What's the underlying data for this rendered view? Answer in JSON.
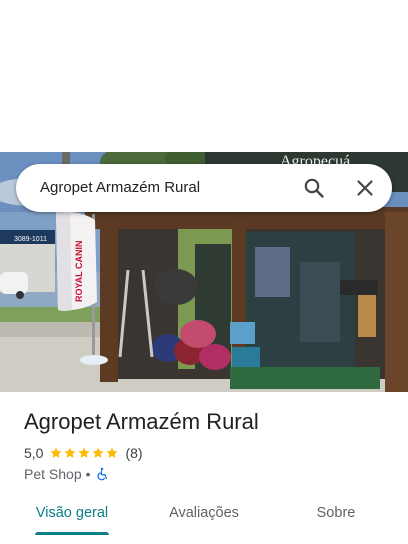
{
  "search": {
    "query": "Agropet Armazém Rural"
  },
  "place": {
    "name": "Agropet Armazém Rural",
    "rating": "5,0",
    "stars": 5,
    "review_count": "(8)",
    "category": "Pet Shop",
    "separator": "•"
  },
  "photo": {
    "storefront_sign": "Agropecuá",
    "flag_brand": "ROYAL CANIN",
    "roadside_sign": "3089-1011"
  },
  "tabs": [
    {
      "label": "Visão geral",
      "active": true
    },
    {
      "label": "Avaliações",
      "active": false
    },
    {
      "label": "Sobre",
      "active": false
    }
  ],
  "colors": {
    "accent": "#0b7f86",
    "star": "#fbbc04"
  },
  "icons": {
    "search": "search-icon",
    "close": "close-icon",
    "accessibility": "wheelchair-icon"
  }
}
